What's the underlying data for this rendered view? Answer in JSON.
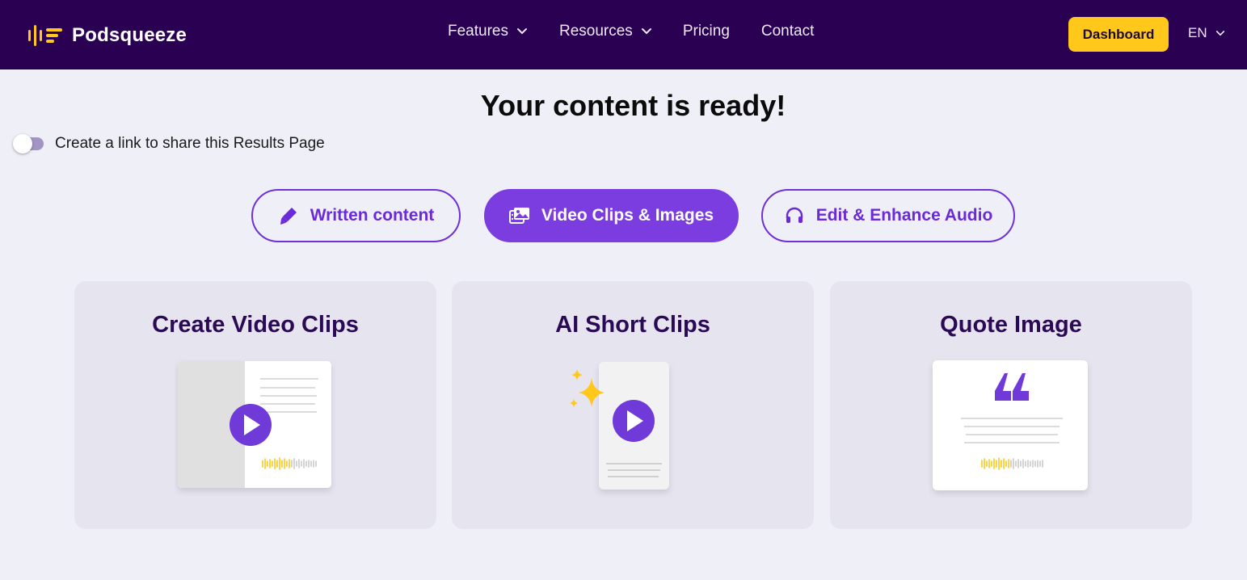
{
  "app": {
    "brand_name": "Podsqueeze",
    "brand_accent": "#ffc81a",
    "nav_bg": "#2a0052"
  },
  "nav": {
    "links": [
      {
        "label": "Features",
        "has_dropdown": true
      },
      {
        "label": "Resources",
        "has_dropdown": true
      },
      {
        "label": "Pricing",
        "has_dropdown": false
      },
      {
        "label": "Contact",
        "has_dropdown": false
      }
    ],
    "dashboard_label": "Dashboard",
    "language": "EN"
  },
  "main": {
    "headline": "Your content is ready!",
    "share_toggle": {
      "label": "Create a link to share this Results Page",
      "enabled": false
    },
    "tabs": [
      {
        "label": "Written content",
        "icon": "highlighter-icon",
        "active": false
      },
      {
        "label": "Video Clips & Images",
        "icon": "images-icon",
        "active": true
      },
      {
        "label": "Edit & Enhance Audio",
        "icon": "headphones-icon",
        "active": false
      }
    ],
    "cards": [
      {
        "title": "Create Video Clips",
        "icon": "video-clip-illustration"
      },
      {
        "title": "AI Short Clips",
        "icon": "short-clip-illustration"
      },
      {
        "title": "Quote Image",
        "icon": "quote-image-illustration"
      }
    ]
  },
  "colors": {
    "primary_purple": "#7b3ddf",
    "page_bg": "#efeff8",
    "card_bg": "#e6e4ef",
    "card_title": "#2b0a55"
  }
}
